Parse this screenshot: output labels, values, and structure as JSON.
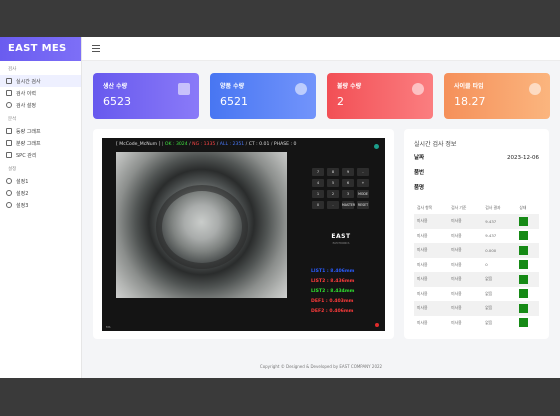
{
  "app": {
    "brand": "EAST MES"
  },
  "sidebar": {
    "sections": [
      {
        "label": "검사",
        "items": [
          {
            "label": "실시간 검사",
            "active": true,
            "icon": "square-icon"
          },
          {
            "label": "검사 이력",
            "icon": "edit-icon"
          },
          {
            "label": "검사 설정",
            "icon": "gear-icon"
          }
        ]
      },
      {
        "label": "분석",
        "items": [
          {
            "label": "등량 그래프",
            "icon": "doc-icon"
          },
          {
            "label": "분량 그래프",
            "icon": "doc-icon"
          },
          {
            "label": "SPC 관리",
            "icon": "chart-icon"
          }
        ]
      },
      {
        "label": "설정",
        "items": [
          {
            "label": "설정1",
            "icon": "gear-icon"
          },
          {
            "label": "설정2",
            "icon": "gear-icon"
          },
          {
            "label": "설정3",
            "icon": "gear-icon"
          }
        ]
      }
    ]
  },
  "cards": [
    {
      "label": "생산 수량",
      "value": "6523",
      "icon": "box-icon"
    },
    {
      "label": "양품 수량",
      "value": "6521",
      "icon": "check-icon"
    },
    {
      "label": "불량 수량",
      "value": "2",
      "icon": "close-icon"
    },
    {
      "label": "사이클 타임",
      "value": "18.27",
      "icon": "clock-icon"
    }
  ],
  "viewer": {
    "title": {
      "prefix": "[ McCode_McNum ]",
      "ok": "OK : 3024",
      "ng": "NG : 1335",
      "all": "ALL : 2351",
      "ct": "CT : 0.01",
      "phase": "PHASE : 0"
    },
    "keys": [
      "7",
      "8",
      "9",
      "-",
      "4",
      "5",
      "6",
      "+",
      "1",
      "2",
      "3",
      "MODE",
      "0",
      ".",
      "MASTER",
      "RESET"
    ],
    "logo": "EAST",
    "logo_sub": "ELECTRONICS",
    "measurements": [
      {
        "text": "LIST1 : 8.406mm",
        "color": "#2a5cff"
      },
      {
        "text": "LIST2 : 8.436mm",
        "color": "#ff3b3b"
      },
      {
        "text": "LIST2 : 8.434mm",
        "color": "#2fe02f"
      },
      {
        "text": "DEF1 : 0.403mm",
        "color": "#ff3b3b"
      },
      {
        "text": "DEF2 : 0.406mm",
        "color": "#ff3b3b"
      }
    ],
    "bottom": "MS"
  },
  "info": {
    "title": "실시간 검사 정보",
    "rows": [
      {
        "label": "날짜",
        "value": "2023-12-06"
      },
      {
        "label": "품번",
        "value": ""
      },
      {
        "label": "품명",
        "value": ""
      }
    ],
    "table": {
      "headers": [
        "검사 항목",
        "검사 기준",
        "검사 결과",
        "상태"
      ],
      "rows": [
        [
          "미사용",
          "미사용",
          "9.437"
        ],
        [
          "미사용",
          "미사용",
          "9.437"
        ],
        [
          "미사용",
          "미사용",
          "0.000"
        ],
        [
          "미사용",
          "미사용",
          "0"
        ],
        [
          "미사용",
          "미사용",
          "없음"
        ],
        [
          "미사용",
          "미사용",
          "없음"
        ],
        [
          "미사용",
          "미사용",
          "없음"
        ],
        [
          "미사용",
          "미사용",
          "없음"
        ]
      ],
      "status_color": "#168a16"
    }
  },
  "footer": "Copyright © Designed & Developed by EAST COMPANY 2022"
}
